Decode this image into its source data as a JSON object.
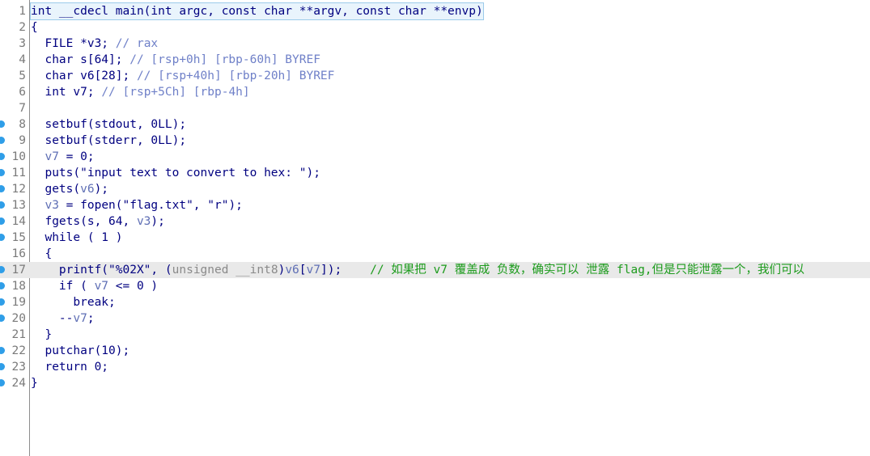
{
  "editor": {
    "lines": [
      {
        "n": "1",
        "bp": false,
        "hl": false,
        "tokens": [
          {
            "t": "int __cdecl main(int argc, const char **argv, const char **envp)",
            "c": "t-dark"
          }
        ]
      },
      {
        "n": "2",
        "bp": false,
        "hl": false,
        "tokens": [
          {
            "t": "{",
            "c": "t-dark"
          }
        ]
      },
      {
        "n": "3",
        "bp": false,
        "hl": false,
        "tokens": [
          {
            "t": "  FILE *v3; ",
            "c": "t-dark"
          },
          {
            "t": "// ",
            "c": "t-cmt-blue"
          },
          {
            "t": "rax",
            "c": "t-cmt-blue"
          }
        ]
      },
      {
        "n": "4",
        "bp": false,
        "hl": false,
        "tokens": [
          {
            "t": "  char s[64]; ",
            "c": "t-dark"
          },
          {
            "t": "// [rsp+0h] [rbp-60h] BYREF",
            "c": "t-cmt-blue"
          }
        ]
      },
      {
        "n": "5",
        "bp": false,
        "hl": false,
        "tokens": [
          {
            "t": "  char v6[28]; ",
            "c": "t-dark"
          },
          {
            "t": "// [rsp+40h] [rbp-20h] BYREF",
            "c": "t-cmt-blue"
          }
        ]
      },
      {
        "n": "6",
        "bp": false,
        "hl": false,
        "tokens": [
          {
            "t": "  int v7; ",
            "c": "t-dark"
          },
          {
            "t": "// [rsp+5Ch] [rbp-4h]",
            "c": "t-cmt-blue"
          }
        ]
      },
      {
        "n": "7",
        "bp": false,
        "hl": false,
        "tokens": [
          {
            "t": "",
            "c": "t-dark"
          }
        ]
      },
      {
        "n": "8",
        "bp": true,
        "hl": false,
        "tokens": [
          {
            "t": "  setbuf(stdout, 0LL);",
            "c": "t-dark"
          }
        ]
      },
      {
        "n": "9",
        "bp": true,
        "hl": false,
        "tokens": [
          {
            "t": "  setbuf(stderr, 0LL);",
            "c": "t-dark"
          }
        ]
      },
      {
        "n": "10",
        "bp": true,
        "hl": false,
        "tokens": [
          {
            "t": "  ",
            "c": "t-dark"
          },
          {
            "t": "v7",
            "c": "t-var"
          },
          {
            "t": " = 0;",
            "c": "t-dark"
          }
        ]
      },
      {
        "n": "11",
        "bp": true,
        "hl": false,
        "tokens": [
          {
            "t": "  puts(",
            "c": "t-dark"
          },
          {
            "t": "\"input text to convert to hex: \"",
            "c": "t-dark"
          },
          {
            "t": ");",
            "c": "t-dark"
          }
        ]
      },
      {
        "n": "12",
        "bp": true,
        "hl": false,
        "tokens": [
          {
            "t": "  gets(",
            "c": "t-dark"
          },
          {
            "t": "v6",
            "c": "t-var"
          },
          {
            "t": ");",
            "c": "t-dark"
          }
        ]
      },
      {
        "n": "13",
        "bp": true,
        "hl": false,
        "tokens": [
          {
            "t": "  ",
            "c": "t-dark"
          },
          {
            "t": "v3",
            "c": "t-var"
          },
          {
            "t": " = fopen(\"flag.txt\", \"r\");",
            "c": "t-dark"
          }
        ]
      },
      {
        "n": "14",
        "bp": true,
        "hl": false,
        "tokens": [
          {
            "t": "  fgets(s, 64, ",
            "c": "t-dark"
          },
          {
            "t": "v3",
            "c": "t-var"
          },
          {
            "t": ");",
            "c": "t-dark"
          }
        ]
      },
      {
        "n": "15",
        "bp": true,
        "hl": false,
        "tokens": [
          {
            "t": "  while ( 1 )",
            "c": "t-dark"
          }
        ]
      },
      {
        "n": "16",
        "bp": false,
        "hl": false,
        "tokens": [
          {
            "t": "  {",
            "c": "t-dark"
          }
        ]
      },
      {
        "n": "17",
        "bp": true,
        "hl": true,
        "tokens": [
          {
            "t": "    printf(",
            "c": "t-dark"
          },
          {
            "t": "\"%02X\"",
            "c": "t-dark"
          },
          {
            "t": ", (",
            "c": "t-dark"
          },
          {
            "t": "unsigned __int8",
            "c": "t-grey"
          },
          {
            "t": ")",
            "c": "t-dark"
          },
          {
            "t": "v6",
            "c": "t-var"
          },
          {
            "t": "[",
            "c": "t-dark"
          },
          {
            "t": "v7",
            "c": "t-var"
          },
          {
            "t": "]);    ",
            "c": "t-dark"
          },
          {
            "t": "// 如果把 v7 覆盖成 负数，确实可以 泄露 flag,但是只能泄露一个，我们可以",
            "c": "t-cmt-cn"
          }
        ]
      },
      {
        "n": "18",
        "bp": true,
        "hl": false,
        "tokens": [
          {
            "t": "    if ( ",
            "c": "t-dark"
          },
          {
            "t": "v7",
            "c": "t-var"
          },
          {
            "t": " <= 0 )",
            "c": "t-dark"
          }
        ]
      },
      {
        "n": "19",
        "bp": true,
        "hl": false,
        "tokens": [
          {
            "t": "      break;",
            "c": "t-dark"
          }
        ]
      },
      {
        "n": "20",
        "bp": true,
        "hl": false,
        "tokens": [
          {
            "t": "    --",
            "c": "t-dark"
          },
          {
            "t": "v7",
            "c": "t-var"
          },
          {
            "t": ";",
            "c": "t-dark"
          }
        ]
      },
      {
        "n": "21",
        "bp": false,
        "hl": false,
        "tokens": [
          {
            "t": "  }",
            "c": "t-dark"
          }
        ]
      },
      {
        "n": "22",
        "bp": true,
        "hl": false,
        "tokens": [
          {
            "t": "  putchar(10);",
            "c": "t-dark"
          }
        ]
      },
      {
        "n": "23",
        "bp": true,
        "hl": false,
        "tokens": [
          {
            "t": "  return 0;",
            "c": "t-dark"
          }
        ]
      },
      {
        "n": "24",
        "bp": true,
        "hl": false,
        "tokens": [
          {
            "t": "}",
            "c": "t-dark"
          }
        ]
      }
    ],
    "colors": {
      "background": "#ffffff",
      "keyword": "#000080",
      "variable": "#5f6fb5",
      "comment_blue": "#6f80c8",
      "comment_green": "#1c9b1c",
      "cast_grey": "#8a8a8a",
      "breakpoint": "#2f9ee8",
      "line_highlight": "#e9e9e9",
      "line_number": "#7a7a7a"
    },
    "icons": {
      "breakpoint": "breakpoint-dot-icon"
    }
  }
}
